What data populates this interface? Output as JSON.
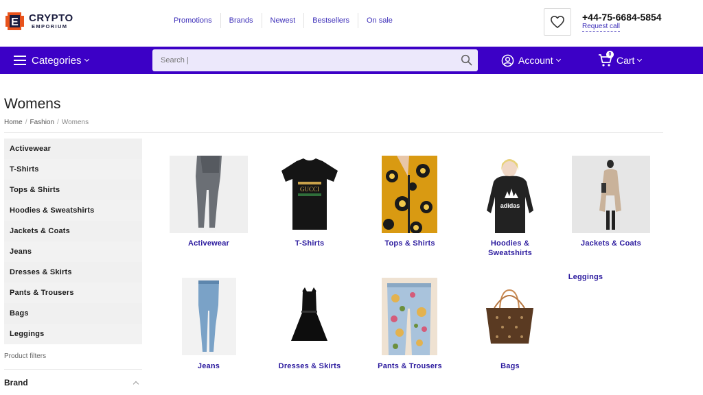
{
  "header": {
    "logo_line1": "CRYPTO",
    "logo_line2": "EMPORIUM",
    "logo_letter": "E",
    "nav": [
      "Promotions",
      "Brands",
      "Newest",
      "Bestsellers",
      "On sale"
    ],
    "phone": "+44-75-6684-5854",
    "request_call": "Request call"
  },
  "bar": {
    "categories_label": "Categories",
    "search_placeholder": "Search |",
    "account_label": "Account",
    "cart_label": "Cart",
    "cart_count": "0"
  },
  "page": {
    "title": "Womens",
    "breadcrumb": [
      "Home",
      "Fashion",
      "Womens"
    ]
  },
  "sidebar": {
    "items": [
      "Activewear",
      "T-Shirts",
      "Tops & Shirts",
      "Hoodies & Sweatshirts",
      "Jackets & Coats",
      "Jeans",
      "Dresses & Skirts",
      "Pants & Trousers",
      "Bags",
      "Leggings"
    ],
    "filters_label": "Product filters",
    "brand_label": "Brand"
  },
  "grid": {
    "labels": [
      "Activewear",
      "T-Shirts",
      "Tops & Shirts",
      "Hoodies & Sweatshirts",
      "Jackets & Coats",
      "Leggings",
      "Jeans",
      "Dresses & Skirts",
      "Pants & Trousers",
      "Bags"
    ],
    "tshirt_print": "GUCCI",
    "hoodie_print": "adidas"
  },
  "colors": {
    "brand_purple": "#3c00c6",
    "link_purple": "#3b2db8",
    "logo_orange": "#e8531c"
  }
}
